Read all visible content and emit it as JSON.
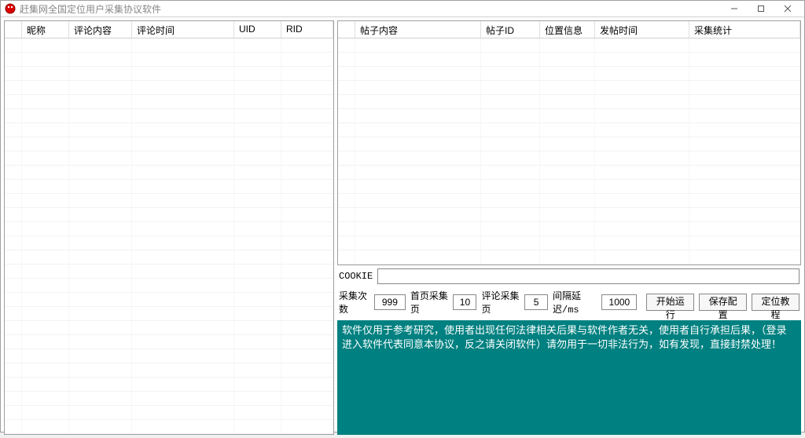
{
  "window": {
    "title": "赶集网全国定位用户采集协议软件"
  },
  "left_table": {
    "headers": [
      "",
      "昵称",
      "评论内容",
      "评论时间",
      "UID",
      "RID"
    ]
  },
  "right_table": {
    "headers": [
      "",
      "帖子内容",
      "帖子ID",
      "位置信息",
      "发帖时间",
      "采集统计"
    ]
  },
  "cookie": {
    "label": "COOKIE",
    "value": ""
  },
  "params": {
    "collect_count_label": "采集次数",
    "collect_count_value": "999",
    "first_page_label": "首页采集页",
    "first_page_value": "10",
    "comment_page_label": "评论采集页",
    "comment_page_value": "5",
    "delay_label": "间隔延迟/ms",
    "delay_value": "1000"
  },
  "buttons": {
    "start": "开始运行",
    "save": "保存配置",
    "tutorial": "定位教程"
  },
  "notice": "软件仅用于参考研究，使用者出现任何法律相关后果与软件作者无关，使用者自行承担后果，（登录进入软件代表同意本协议，反之请关闭软件）请勿用于一切非法行为，如有发现，直接封禁处理！"
}
